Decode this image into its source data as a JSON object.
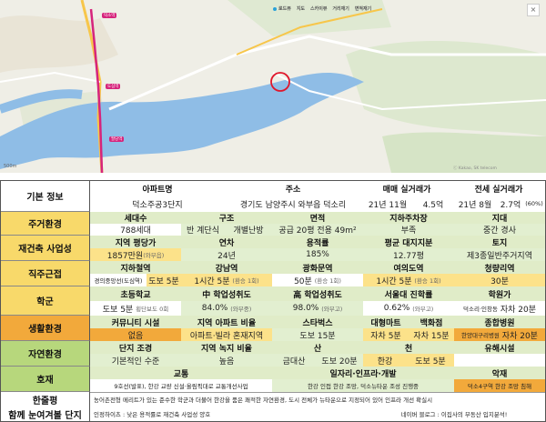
{
  "map": {
    "toolbar": [
      "로드뷰",
      "지도",
      "스카이뷰",
      "거리재기",
      "면적재기"
    ],
    "close": "×",
    "scale": "500m",
    "copyright": "ⓒ Kakao, SK telecom",
    "stations": [
      "덕소역",
      "도심역",
      "팔당역"
    ]
  },
  "rows": {
    "basic": {
      "label": "기본 정보",
      "h": [
        "아파트명",
        "주소",
        "매매 실거래가",
        "전세 실거래가"
      ],
      "name": "덕소주공3단지",
      "addr": "경기도 남양주시 와부읍 덕소리",
      "sale_date": "21년 11월",
      "sale_price": "4.5억",
      "jeonse_date": "21년 8월",
      "jeonse_price": "2.7억",
      "jeonse_ratio": "(60%)"
    },
    "living": {
      "label": "주거환경",
      "h": [
        "세대수",
        "구조",
        "면적",
        "지하주차장",
        "지대"
      ],
      "v": [
        "788세대",
        "반 계단식",
        "개별난방",
        "공급 20평  전용 49m²",
        "부족",
        "중간 경사"
      ]
    },
    "rebuild": {
      "label": "재건축 사업성",
      "h": [
        "지역 평당가",
        "연차",
        "용적률",
        "평균 대지지분",
        "토지"
      ],
      "price": "1857만원",
      "price_note": "(와부읍)",
      "v": [
        "24년",
        "185%",
        "12.77평",
        "제3종일반주거지역"
      ]
    },
    "commute": {
      "label": "직주근접",
      "h": [
        "지하철역",
        "강남역",
        "광화문역",
        "여의도역",
        "청량리역"
      ],
      "station": "경의중앙선(도심역)",
      "walk": "도보 5분",
      "v": [
        "1시간 5분",
        "(환승 1회)",
        "50분",
        "(환승 1회)",
        "1시간 5분",
        "(환승 1회)",
        "30분"
      ]
    },
    "school": {
      "label": "학군",
      "h": [
        "초등학교",
        "中 학업성취도",
        "高 학업성취도",
        "서울대 진학률",
        "학원가"
      ],
      "v": [
        "도보 5분",
        "횡단보도 0회",
        "84.0%",
        "(와부중)",
        "98.0%",
        "(와부고)",
        "0.62%",
        "(와부고)",
        "덕소리·인창동",
        "자차 20분"
      ]
    },
    "life": {
      "label": "생활환경",
      "h": [
        "커뮤니티 시설",
        "지역 아파트 비율",
        "스타벅스",
        "대형마트",
        "백화점",
        "종합병원"
      ],
      "v": [
        "없음",
        "아파트·빌라 혼재지역",
        "도보 15분",
        "자차 5분",
        "자차 15분",
        "한양대구리병원",
        "자차 20분"
      ]
    },
    "nature": {
      "label": "자연환경",
      "h": [
        "단지 조경",
        "지역 녹지 비율",
        "산",
        "천",
        "유해시설"
      ],
      "v": [
        "기본적인 수준",
        "높음",
        "금대산",
        "도보 20분",
        "한강",
        "도보 5분"
      ]
    },
    "favor": {
      "label": "호재",
      "h": [
        "교통",
        "일자리·인프라·개발",
        "악재"
      ],
      "v": [
        "9호선(발표), 한강 교량 신설·올림픽대로 교통개선사업",
        "한강 인접 한강 조망, 덕소뉴타운 조성 진행중",
        "덕소4구역 한강 조망 침해"
      ]
    },
    "summary": {
      "label1": "한줄평",
      "label2": "함께 눈여겨볼 단지",
      "line1": "농어촌전형 메리트가 있는 준수한 학군과 더불어 한강을 품은 쾌적한 자연환경, 도시 전체가 뉴타운으로 지정되어 있어 인프라 개선 확실시",
      "line2": "인정하이츠 : 낮은 용적률로 재건축 사업성 양호",
      "credit": "네이버 블로그 : 이집사의 부동산 입지분석!"
    }
  },
  "colors": {
    "label_yellow": "#f8d96a",
    "label_green": "#b7d77c",
    "header_green": "#e0ecc8",
    "value_green": "#e2efd0",
    "orange": "#f2a93b",
    "yellow_fill": "#fce28a",
    "river": "#8fbde6",
    "route": "#d6247c"
  }
}
